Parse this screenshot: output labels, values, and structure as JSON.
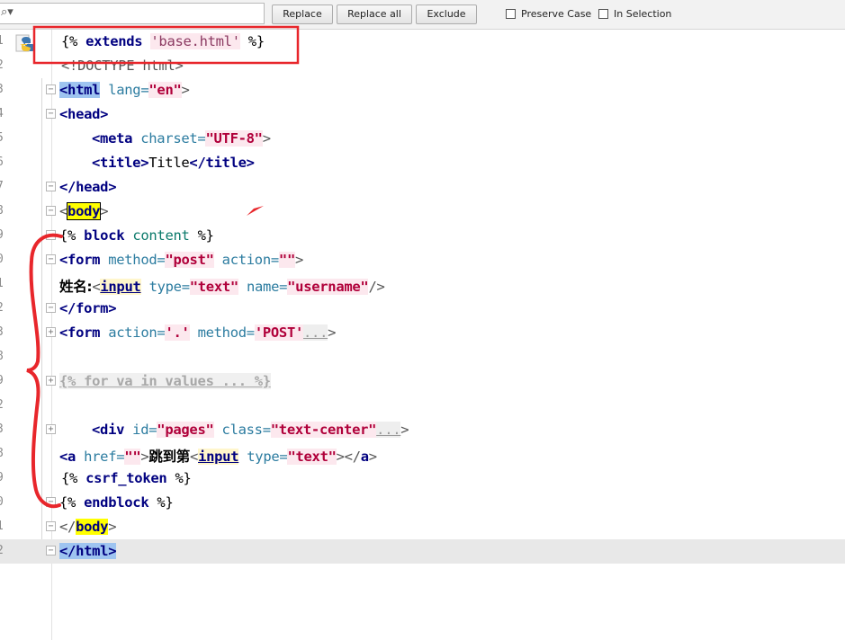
{
  "toolbar": {
    "search_icon": "search-icon",
    "replace_label": "Replace",
    "replace_all_label": "Replace all",
    "exclude_label": "Exclude",
    "preserve_case_label": "Preserve Case",
    "in_selection_label": "In Selection"
  },
  "editor": {
    "line_numbers": [
      "1",
      "2",
      "3",
      "4",
      "5",
      "6",
      "7",
      "8",
      "9",
      "0",
      "1",
      "2",
      "3",
      "8",
      "9",
      "2",
      "3",
      "8",
      "9",
      "0",
      "1",
      "2"
    ],
    "l1": {
      "open": "{% ",
      "kw": "extends",
      "str": "'base.html'",
      "close": " %}"
    },
    "l2": {
      "text": "<!DOCTYPE html>"
    },
    "l3": {
      "tag": "<html",
      "attr": " lang=",
      "val": "\"en\"",
      "close": ">"
    },
    "l4": {
      "tag": "<head>"
    },
    "l5": {
      "tag": "<meta",
      "attr": " charset=",
      "val": "\"UTF-8\"",
      "close": ">"
    },
    "l6": {
      "open": "<title>",
      "text": "Title",
      "close": "</title>"
    },
    "l7": {
      "tag": "</head>"
    },
    "l8": {
      "lt": "<",
      "tag": "body",
      "gt": ">"
    },
    "l9": {
      "open": "{% ",
      "kw": "block",
      "name": " content",
      "close": " %}"
    },
    "l10": {
      "tag": "<form",
      "a1": " method=",
      "v1": "\"post\"",
      "a2": " action=",
      "v2": "\"\"",
      "close": ">"
    },
    "l11": {
      "cn": "姓名:",
      "lt": "<",
      "tag": "input",
      "a1": " type=",
      "v1": "\"text\"",
      "a2": " name=",
      "v2": "\"username\"",
      "close": "/>"
    },
    "l12": {
      "tag": "</form>"
    },
    "l13": {
      "tag": "<form",
      "a1": " action=",
      "v1": "'.'",
      "a2": " method=",
      "v2": "'POST'",
      "ell": "...",
      "close": ">"
    },
    "l19": {
      "text": "{% for va in values ... %}"
    },
    "l23": {
      "tag": "<div",
      "a1": " id=",
      "v1": "\"pages\"",
      "a2": " class=",
      "v2": "\"text-center\"",
      "ell": "...",
      "close": ">"
    },
    "l28": {
      "tag": "<a",
      "a1": " href=",
      "v1": "\"\"",
      "gt": ">",
      "cn": "跳到第",
      "lt": "<",
      "tag2": "input",
      "a2": " type=",
      "v2": "\"text\"",
      "close": "></",
      "tag3": "a",
      "end": ">"
    },
    "l29": {
      "open": "{% ",
      "kw": "csrf_token",
      "close": " %}"
    },
    "l30": {
      "open": "{% ",
      "kw": "endblock",
      "close": " %}"
    },
    "l31": {
      "lt": "</",
      "tag": "body",
      "gt": ">"
    },
    "l32": {
      "tag": "</html>"
    }
  }
}
